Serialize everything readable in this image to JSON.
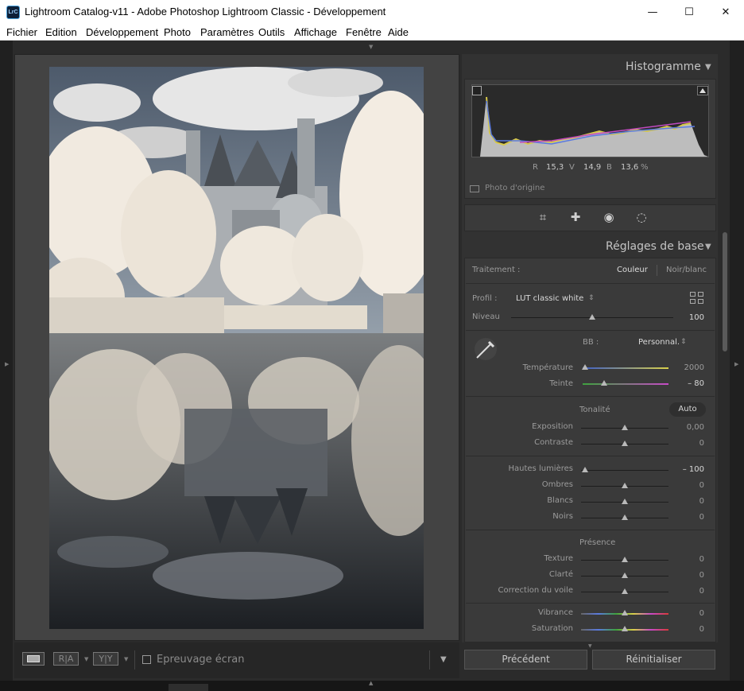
{
  "window": {
    "title": "Lightroom Catalog-v11 - Adobe Photoshop Lightroom Classic - Développement",
    "app_icon_text": "LrC",
    "controls": {
      "minimize": "—",
      "maximize": "☐",
      "close": "✕"
    }
  },
  "menu": [
    "Fichier",
    "Edition",
    "Développement",
    "Photo",
    "Paramètres",
    "Outils",
    "Affichage",
    "Fenêtre",
    "Aide"
  ],
  "toolbar": {
    "compare_left": "R|A",
    "compare_right": "Y|Y",
    "softproof_label": "Epreuvage écran"
  },
  "histogram": {
    "title": "Histogramme",
    "r_label": "R",
    "r_value": "15,3",
    "g_label": "V",
    "g_value": "14,9",
    "b_label": "B",
    "b_value": "13,6",
    "percent": "%",
    "original_label": "Photo d'origine"
  },
  "tools": [
    "crop-tool",
    "healing-tool",
    "red-eye-tool",
    "masking-tool"
  ],
  "basic": {
    "title": "Réglages de base",
    "treatment_label": "Traitement :",
    "treatment_color": "Couleur",
    "treatment_bw": "Noir/blanc",
    "profile_label": "Profil :",
    "profile_value": "LUT classic white",
    "amount_label": "Niveau",
    "amount_value": "100",
    "wb_label": "BB :",
    "wb_value": "Personnal.",
    "temp_label": "Température",
    "temp_value": "2000",
    "tint_label": "Teinte",
    "tint_value": "– 80",
    "tone_label": "Tonalité",
    "auto_label": "Auto",
    "exposure_label": "Exposition",
    "exposure_value": "0,00",
    "contrast_label": "Contraste",
    "contrast_value": "0",
    "highlights_label": "Hautes lumières",
    "highlights_value": "– 100",
    "shadows_label": "Ombres",
    "shadows_value": "0",
    "whites_label": "Blancs",
    "whites_value": "0",
    "blacks_label": "Noirs",
    "blacks_value": "0",
    "presence_label": "Présence",
    "texture_label": "Texture",
    "texture_value": "0",
    "clarity_label": "Clarté",
    "clarity_value": "0",
    "dehaze_label": "Correction du voile",
    "dehaze_value": "0",
    "vibrance_label": "Vibrance",
    "vibrance_value": "0",
    "saturation_label": "Saturation",
    "saturation_value": "0"
  },
  "actions": {
    "previous": "Précédent",
    "reset": "Réinitialiser"
  },
  "colors": {
    "panel_bg": "#323232",
    "block_bg": "#3a3a3a",
    "text": "#9b9b9b",
    "header_text": "#c4c4c4",
    "accent": "#4aa3e0"
  }
}
